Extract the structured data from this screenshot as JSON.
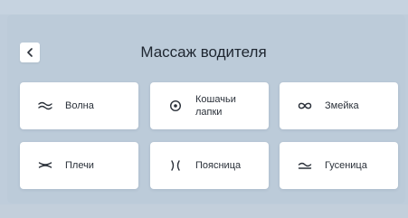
{
  "header": {
    "title": "Массаж водителя",
    "back_icon": "chevron-left-icon"
  },
  "modes": [
    {
      "label": "Волна",
      "icon": "wave-icon"
    },
    {
      "label": "Кошачьи лапки",
      "icon": "cat-paws-icon"
    },
    {
      "label": "Змейка",
      "icon": "infinity-icon"
    },
    {
      "label": "Плечи",
      "icon": "shoulders-icon"
    },
    {
      "label": "Поясница",
      "icon": "lower-back-icon"
    },
    {
      "label": "Гусеница",
      "icon": "caterpillar-icon"
    }
  ],
  "colors": {
    "background": "#bfcddb",
    "tile": "#ffffff",
    "text": "#2a3039"
  }
}
